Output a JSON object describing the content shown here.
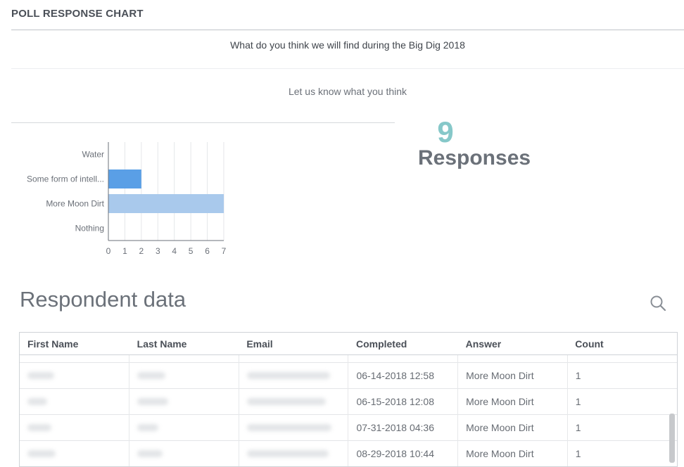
{
  "header": {
    "title": "POLL RESPONSE CHART"
  },
  "poll": {
    "question": "What do you think we will find during the Big Dig 2018",
    "subtitle": "Let us know what you think"
  },
  "summary": {
    "count": "9",
    "label": "Responses"
  },
  "chart_data": {
    "type": "bar",
    "orientation": "horizontal",
    "categories": [
      "Water",
      "Some form of intell...",
      "More Moon Dirt",
      "Nothing"
    ],
    "values": [
      0,
      2,
      7,
      0
    ],
    "bar_colors": [
      "#5a9fe6",
      "#5a9fe6",
      "#a9c9ec",
      "#5a9fe6"
    ],
    "xticks": [
      "0",
      "1",
      "2",
      "3",
      "4",
      "5",
      "6",
      "7"
    ],
    "xlim": [
      0,
      7
    ],
    "grid": true
  },
  "respondents": {
    "title": "Respondent data",
    "columns": [
      "First Name",
      "Last Name",
      "Email",
      "Completed",
      "Answer",
      "Count"
    ],
    "rows": [
      {
        "completed": "06-14-2018 12:58",
        "answer": "More Moon Dirt",
        "count": "1"
      },
      {
        "completed": "06-15-2018 12:08",
        "answer": "More Moon Dirt",
        "count": "1"
      },
      {
        "completed": "07-31-2018 04:36",
        "answer": "More Moon Dirt",
        "count": "1"
      },
      {
        "completed": "08-29-2018 10:44",
        "answer": "More Moon Dirt",
        "count": "1"
      }
    ]
  },
  "icons": {
    "search": "search-icon"
  },
  "colors": {
    "accent": "#86c8c9",
    "bar_primary": "#5a9fe6",
    "bar_light": "#a9c9ec"
  }
}
